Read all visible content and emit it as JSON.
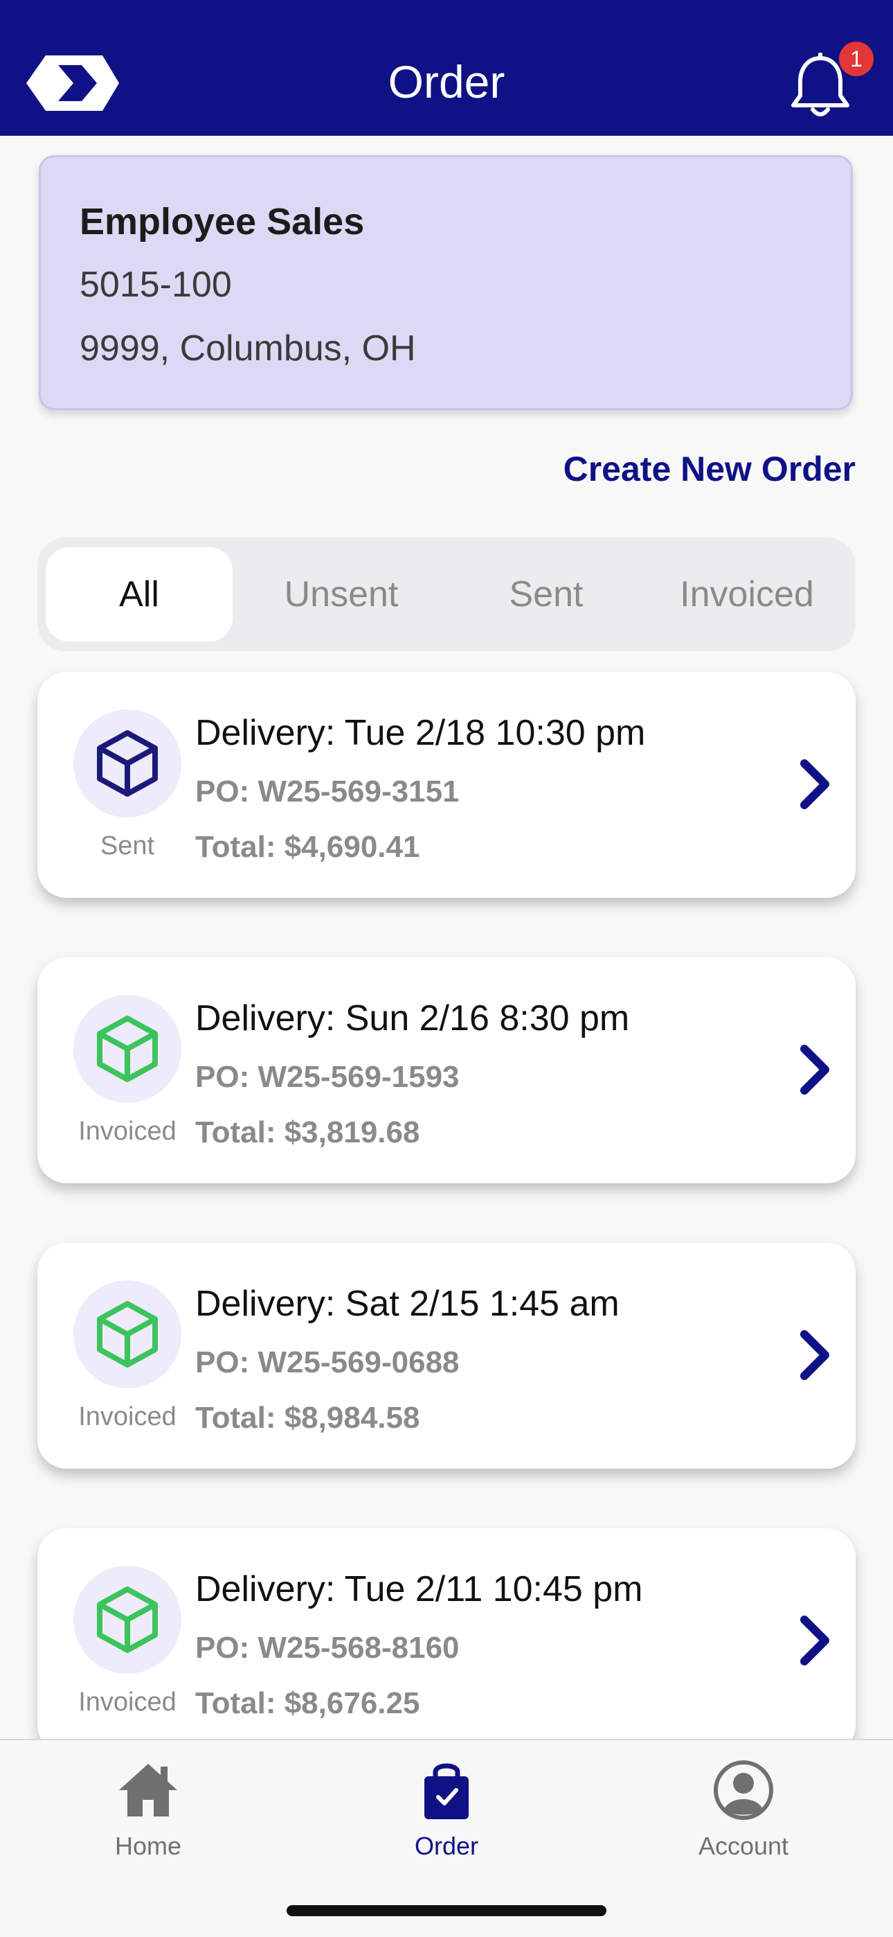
{
  "header": {
    "title": "Order",
    "notification_count": "1",
    "icons": {
      "logo": "chevron-logo",
      "notifications": "bell-icon"
    }
  },
  "customer": {
    "name": "Employee Sales",
    "number": "5015-100",
    "address": "9999, Columbus, OH"
  },
  "actions": {
    "create_order": "Create New Order"
  },
  "tabs": [
    {
      "label": "All",
      "active": true
    },
    {
      "label": "Unsent",
      "active": false
    },
    {
      "label": "Sent",
      "active": false
    },
    {
      "label": "Invoiced",
      "active": false
    }
  ],
  "orders": [
    {
      "status": "Sent",
      "delivery": "Delivery: Tue 2/18 10:30 pm",
      "po": "PO: W25-569-3151",
      "total": "Total: $4,690.41"
    },
    {
      "status": "Invoiced",
      "delivery": "Delivery: Sun 2/16 8:30 pm",
      "po": "PO: W25-569-1593",
      "total": "Total: $3,819.68"
    },
    {
      "status": "Invoiced",
      "delivery": "Delivery: Sat 2/15 1:45 am",
      "po": "PO: W25-569-0688",
      "total": "Total: $8,984.58"
    },
    {
      "status": "Invoiced",
      "delivery": "Delivery: Tue 2/11 10:45 pm",
      "po": "PO: W25-568-8160",
      "total": "Total: $8,676.25"
    }
  ],
  "status_colors": {
    "Sent": "#1a1a7a",
    "Invoiced": "#3cc45c"
  },
  "colors": {
    "brand": "#0f1285",
    "badge": "#e33636",
    "customer_card": "#ddd9f5"
  },
  "bottom_nav": [
    {
      "label": "Home",
      "icon": "home-icon",
      "active": false
    },
    {
      "label": "Order",
      "icon": "shopping-bag-icon",
      "active": true
    },
    {
      "label": "Account",
      "icon": "account-icon",
      "active": false
    }
  ]
}
